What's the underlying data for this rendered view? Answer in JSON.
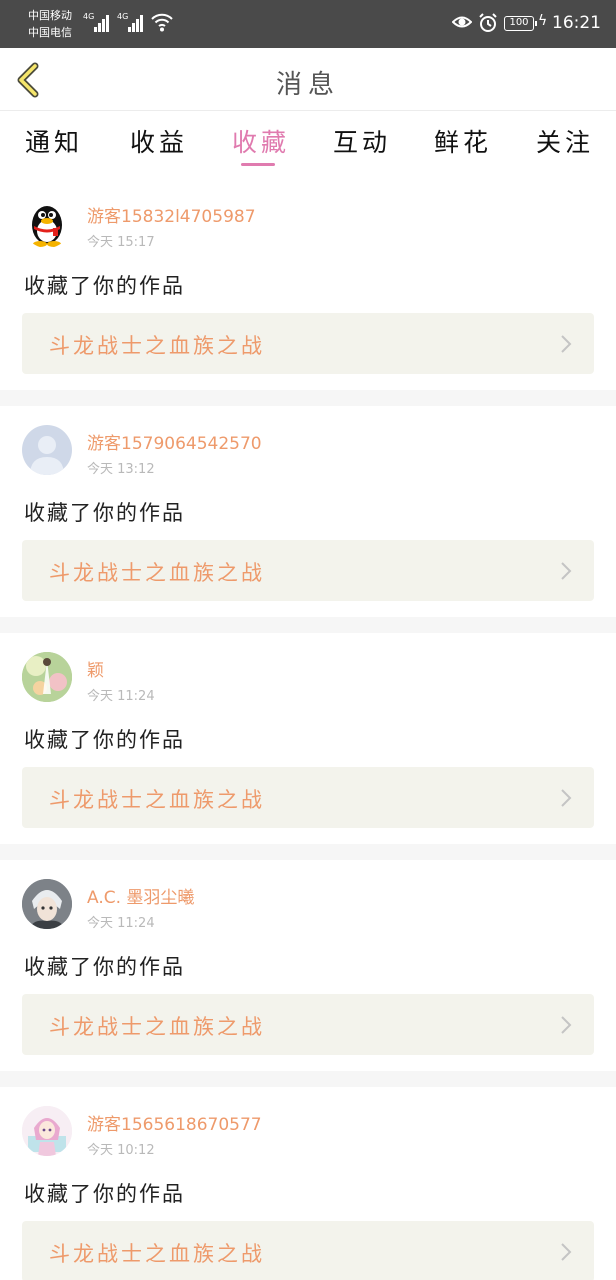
{
  "status_bar": {
    "carrier_1": "中国移动",
    "carrier_2": "中国电信",
    "sim_1_network": "4G",
    "sim_2_network": "4G",
    "battery": "100",
    "time": "16:21"
  },
  "header": {
    "title": "消息",
    "back_icon": "chevron-left-icon"
  },
  "tabs": [
    {
      "label": "通知",
      "active": false
    },
    {
      "label": "收益",
      "active": false
    },
    {
      "label": "收藏",
      "active": true
    },
    {
      "label": "互动",
      "active": false
    },
    {
      "label": "鲜花",
      "active": false
    },
    {
      "label": "关注",
      "active": false
    }
  ],
  "colors": {
    "accent": "#e07baf",
    "username": "#ee9a6b",
    "status_bar": "#4a4a4a",
    "link_bg": "#f3f3ec"
  },
  "messages": [
    {
      "user": "游客15832l4705987",
      "time": "今天 15:17",
      "action": "收藏了你的作品",
      "work": "斗龙战士之血族之战",
      "avatar": "penguin-avatar"
    },
    {
      "user": "游客1579064542570",
      "time": "今天 13:12",
      "action": "收藏了你的作品",
      "work": "斗龙战士之血族之战",
      "avatar": "default-avatar"
    },
    {
      "user": "颖",
      "time": "今天 11:24",
      "action": "收藏了你的作品",
      "work": "斗龙战士之血族之战",
      "avatar": "flower-avatar"
    },
    {
      "user": "A.C. 墨羽尘曦",
      "time": "今天 11:24",
      "action": "收藏了你的作品",
      "work": "斗龙战士之血族之战",
      "avatar": "anime-avatar"
    },
    {
      "user": "游客1565618670577",
      "time": "今天 10:12",
      "action": "收藏了你的作品",
      "work": "斗龙战士之血族之战",
      "avatar": "girl-avatar"
    }
  ]
}
